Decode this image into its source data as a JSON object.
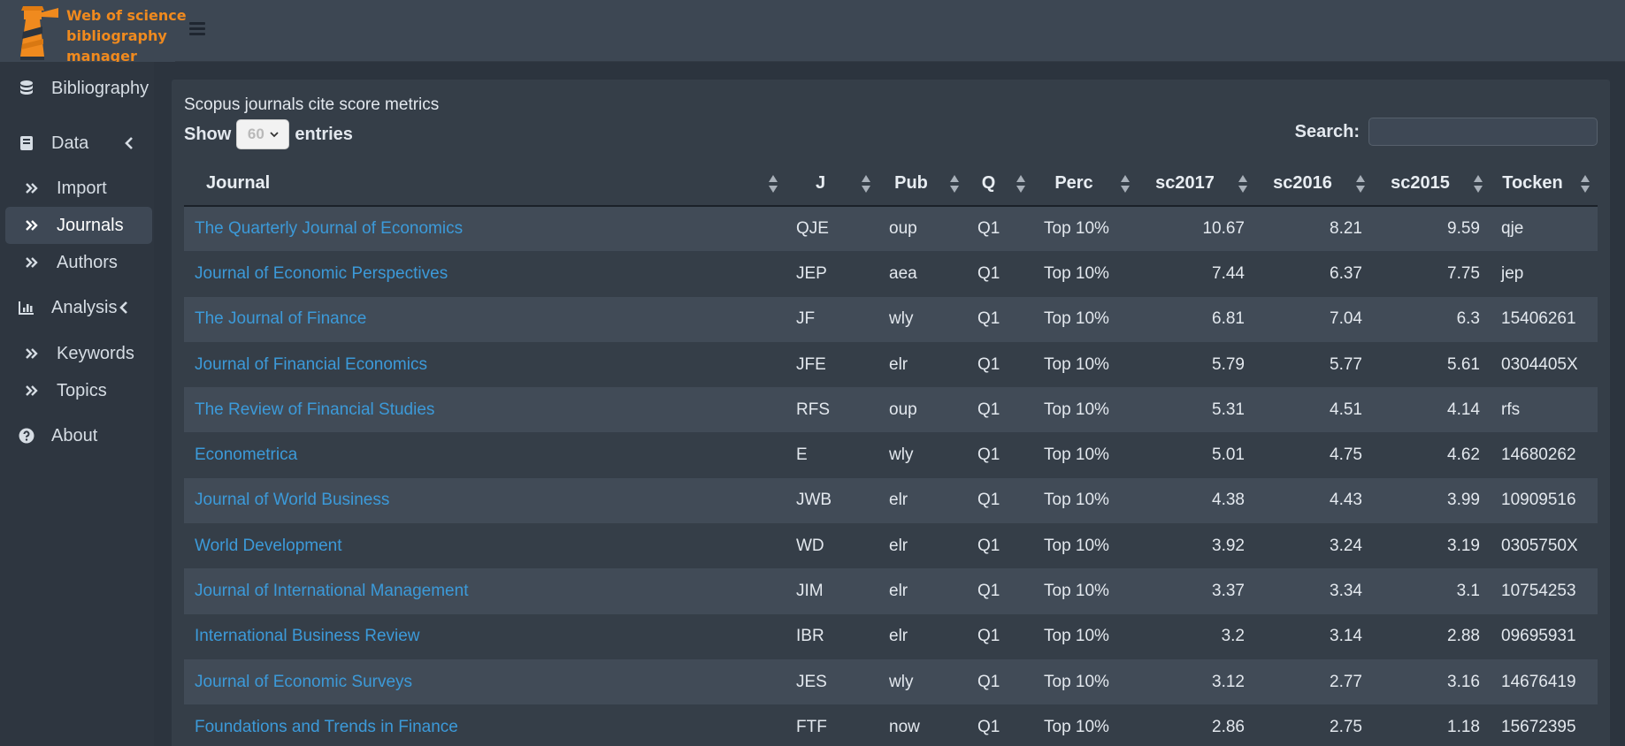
{
  "app": {
    "logo_lines": [
      "Web of science",
      "bibliography",
      "manager"
    ]
  },
  "sidebar": {
    "items": [
      {
        "label": "Bibliography",
        "icon": "database-icon"
      },
      {
        "label": "Data",
        "icon": "book-icon"
      },
      {
        "label": "Import",
        "icon": "double-chevron-right-icon"
      },
      {
        "label": "Journals",
        "icon": "double-chevron-right-icon",
        "active": true
      },
      {
        "label": "Authors",
        "icon": "double-chevron-right-icon"
      },
      {
        "label": "Analysis",
        "icon": "bar-chart-icon"
      },
      {
        "label": "Keywords",
        "icon": "double-chevron-right-icon"
      },
      {
        "label": "Topics",
        "icon": "double-chevron-right-icon"
      },
      {
        "label": "About",
        "icon": "question-circle-icon"
      }
    ]
  },
  "main": {
    "title": "Scopus journals cite score metrics",
    "show_label": "Show",
    "entries_label": "entries",
    "length_value": "60",
    "search_label": "Search:",
    "search_value": ""
  },
  "table": {
    "columns": [
      "Journal",
      "J",
      "Pub",
      "Q",
      "Perc",
      "sc2017",
      "sc2016",
      "sc2015",
      "Tocken"
    ],
    "rows": [
      [
        "The Quarterly Journal of Economics",
        "QJE",
        "oup",
        "Q1",
        "Top 10%",
        "10.67",
        "8.21",
        "9.59",
        "qje"
      ],
      [
        "Journal of Economic Perspectives",
        "JEP",
        "aea",
        "Q1",
        "Top 10%",
        "7.44",
        "6.37",
        "7.75",
        "jep"
      ],
      [
        "The Journal of Finance",
        "JF",
        "wly",
        "Q1",
        "Top 10%",
        "6.81",
        "7.04",
        "6.3",
        "15406261"
      ],
      [
        "Journal of Financial Economics",
        "JFE",
        "elr",
        "Q1",
        "Top 10%",
        "5.79",
        "5.77",
        "5.61",
        "0304405X"
      ],
      [
        "The Review of Financial Studies",
        "RFS",
        "oup",
        "Q1",
        "Top 10%",
        "5.31",
        "4.51",
        "4.14",
        "rfs"
      ],
      [
        "Econometrica",
        "E",
        "wly",
        "Q1",
        "Top 10%",
        "5.01",
        "4.75",
        "4.62",
        "14680262"
      ],
      [
        "Journal of World Business",
        "JWB",
        "elr",
        "Q1",
        "Top 10%",
        "4.38",
        "4.43",
        "3.99",
        "10909516"
      ],
      [
        "World Development",
        "WD",
        "elr",
        "Q1",
        "Top 10%",
        "3.92",
        "3.24",
        "3.19",
        "0305750X"
      ],
      [
        "Journal of International Management",
        "JIM",
        "elr",
        "Q1",
        "Top 10%",
        "3.37",
        "3.34",
        "3.1",
        "10754253"
      ],
      [
        "International Business Review",
        "IBR",
        "elr",
        "Q1",
        "Top 10%",
        "3.2",
        "3.14",
        "2.88",
        "09695931"
      ],
      [
        "Journal of Economic Surveys",
        "JES",
        "wly",
        "Q1",
        "Top 10%",
        "3.12",
        "2.77",
        "3.16",
        "14676419"
      ],
      [
        "Foundations and Trends in Finance",
        "FTF",
        "now",
        "Q1",
        "Top 10%",
        "2.86",
        "2.75",
        "1.18",
        "15672395"
      ]
    ]
  },
  "colors": {
    "accent_orange": "#f08a1e",
    "link_blue": "#3c9ad9"
  }
}
